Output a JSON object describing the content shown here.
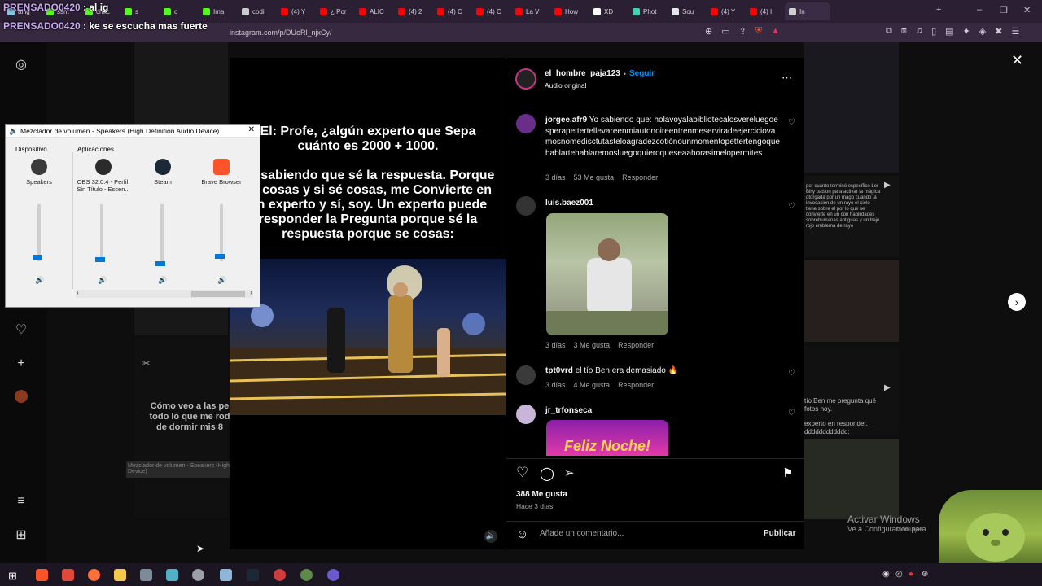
{
  "browser": {
    "tabs": [
      {
        "label": "al ig",
        "fav": "#7ec8e3"
      },
      {
        "label": "ssnt",
        "fav": "#53fc18"
      },
      {
        "label": "chac",
        "fav": "#53fc18"
      },
      {
        "label": "s",
        "fav": "#53fc18"
      },
      {
        "label": "c",
        "fav": "#53fc18"
      },
      {
        "label": "Ima",
        "fav": "#53fc18"
      },
      {
        "label": "codi",
        "fav": "#cccccc"
      },
      {
        "label": "(4) Y",
        "fav": "#ff0000"
      },
      {
        "label": "¿ Por",
        "fav": "#ff0000"
      },
      {
        "label": "ALIC",
        "fav": "#ff0000"
      },
      {
        "label": "(4) 2",
        "fav": "#ff0000"
      },
      {
        "label": "(4) C",
        "fav": "#ff0000"
      },
      {
        "label": "(4) C",
        "fav": "#ff0000"
      },
      {
        "label": "La V",
        "fav": "#ff0000"
      },
      {
        "label": "How",
        "fav": "#ff0000"
      },
      {
        "label": "XD",
        "fav": "#ffffff"
      },
      {
        "label": "Phot",
        "fav": "#3fd1b4"
      },
      {
        "label": "Sou",
        "fav": "#e6e6e6"
      },
      {
        "label": "(4) Y",
        "fav": "#ff0000"
      },
      {
        "label": "(4) I",
        "fav": "#ff0000"
      },
      {
        "label": "In",
        "fav": "#d0d0d0"
      }
    ],
    "url": "instagram.com/p/DUoRl_njxCy/",
    "new_tab": "+",
    "min": "–",
    "max": "❐",
    "close": "✕"
  },
  "chat": [
    {
      "user": "PRENSADO0420",
      "msg": " : al ig"
    },
    {
      "user": "PRENSADO0420",
      "msg": " : ke se escucha mas fuerte"
    }
  ],
  "mixer": {
    "title": "Mezclador de volumen - Speakers (High Definition Audio Device)",
    "device_label": "Dispositivo",
    "apps_label": "Aplicaciones",
    "columns": [
      {
        "name": "Speakers",
        "level": 0.0
      },
      {
        "name": "OBS 32.0.4 - Perfil: Sin Título - Escen...",
        "level": 0.0
      },
      {
        "name": "Steam",
        "level": 0.0
      },
      {
        "name": "Brave Browser",
        "level": 0.0
      }
    ]
  },
  "post": {
    "meme_top": "El: Profe, ¿algún experto que Sepa cuánto es 2000 + 1000.",
    "meme_bottom": "Yo sabiendo que sé la respuesta. Porque sé cosas y si sé cosas, me Convierte en un experto y sí, soy. Un experto puede responder la Pregunta porque sé la respuesta porque se cosas:",
    "author": "el_hombre_paja123",
    "follow": "Seguir",
    "dot": "•",
    "audio": "Audio original",
    "comments": [
      {
        "user": "jorgee.afr9",
        "text": "Yo sabiendo que: holavoyalabibliotecalosvereluegoesperapettertellevareenmiautonoireentrenmeserviradeejerciciovamosnomedisctutasteloagradezcotiónounmomentopettertengoquehablartehablaremosluegoquieroqueseaahorasimelopermites",
        "time": "3 días",
        "likes": "53 Me gusta",
        "reply": "Responder"
      },
      {
        "user": "luis.baez001",
        "text": "",
        "time": "3 días",
        "likes": "3 Me gusta",
        "reply": "Responder"
      },
      {
        "user": "tpt0vrd",
        "text": "el tío Ben era demasiado 🔥",
        "time": "3 días",
        "likes": "4 Me gusta",
        "reply": "Responder"
      },
      {
        "user": "jr_trfonseca",
        "text": "",
        "time": "",
        "likes": "",
        "reply": ""
      }
    ],
    "gif_text": "Feliz Noche!",
    "like_count": "388 Me gusta",
    "posted": "Hace 3 días",
    "add_comment_placeholder": "Añade un comentario...",
    "publish": "Publicar"
  },
  "background": {
    "left_text": "Cómo veo a las pe todo lo que me rod de dormir mis 8",
    "right_text_1": "por cuanto terminó específico Ler Billy batson para activar la mágica otorgada por un mago cuando la invocación de un rayo el cielo tiene sobre el por lo que se convierte en un con habilidades sobrehumanas antiguas y un traje rojo emblema de rayo",
    "right_text_2": "tío Ben me pregunta qué fotos hoy.",
    "right_text_3": "experto en responder. dddddddddddd:",
    "mixer_ghost": "Mezclador de volumen - Speakers (High Definition Audio Device)"
  },
  "windows_watermark": {
    "line1": "Activar Windows",
    "line2": "Ve a Configuración para"
  },
  "overlay_corner": "Mensajes",
  "colors": {
    "accent_blue": "#0095f6",
    "mixer_blue": "#0078d7",
    "twitch_purple": "#c7a9f2"
  }
}
